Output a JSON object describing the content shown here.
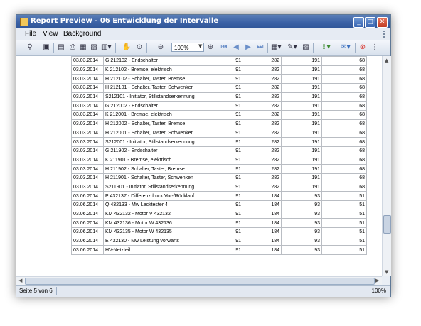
{
  "window": {
    "title": "Report Preview - 06 Entwicklung der Intervalle",
    "min_icon": "minimize-icon",
    "max_icon": "maximize-icon",
    "close_icon": "close-icon"
  },
  "menu": {
    "items": [
      "File",
      "View",
      "Background"
    ]
  },
  "toolbar": {
    "zoom_value": "100%",
    "icons": [
      "find-icon",
      "open-icon",
      "page-setup-icon",
      "print-icon",
      "quick-print-icon",
      "scale-icon",
      "multipage-icon",
      "hand-tool-icon",
      "magnifier-icon",
      "zoom-out-icon",
      "zoom-in-icon",
      "first-page-icon",
      "previous-page-icon",
      "next-page-icon",
      "last-page-icon",
      "watermark-icon",
      "background-color-icon",
      "page-layout-icon",
      "export-icon",
      "send-email-icon",
      "close-preview-icon"
    ]
  },
  "report": {
    "rows": [
      [
        "03.03.2014",
        "G 212102 - Endschalter",
        "91",
        "282",
        "191",
        "68"
      ],
      [
        "03.03.2014",
        "K 212102 - Bremse, elektrisch",
        "91",
        "282",
        "191",
        "68"
      ],
      [
        "03.03.2014",
        "H 212102 - Schalter, Taster, Bremse",
        "91",
        "282",
        "191",
        "68"
      ],
      [
        "03.03.2014",
        "H 212101 - Schalter, Taster, Schwenken",
        "91",
        "282",
        "191",
        "68"
      ],
      [
        "03.03.2014",
        "S212101 - Initiator, Stillstandserkennung",
        "91",
        "282",
        "191",
        "68"
      ],
      [
        "03.03.2014",
        "G 212002 - Endschalter",
        "91",
        "282",
        "191",
        "68"
      ],
      [
        "03.03.2014",
        "K 212001 - Bremse, elektrisch",
        "91",
        "282",
        "191",
        "68"
      ],
      [
        "03.03.2014",
        "H 212002 - Schalter, Taster, Bremse",
        "91",
        "282",
        "191",
        "68"
      ],
      [
        "03.03.2014",
        "H 212001 - Schalter, Taster, Schwenken",
        "91",
        "282",
        "191",
        "68"
      ],
      [
        "03.03.2014",
        "S212001 - Initiator, Stillstandserkennung",
        "91",
        "282",
        "191",
        "68"
      ],
      [
        "03.03.2014",
        "G 211902 - Endschalter",
        "91",
        "282",
        "191",
        "68"
      ],
      [
        "03.03.2014",
        "K 211901 - Bremse, elektrisch",
        "91",
        "282",
        "191",
        "68"
      ],
      [
        "03.03.2014",
        "H 211902 - Schalter, Taster, Bremse",
        "91",
        "282",
        "191",
        "68"
      ],
      [
        "03.03.2014",
        "H 211901 - Schalter, Taster, Schwenken",
        "91",
        "282",
        "191",
        "68"
      ],
      [
        "03.03.2014",
        "S211901 - Initiator, Stillstandserkennung",
        "91",
        "282",
        "191",
        "68"
      ],
      [
        "03.06.2014",
        "P 432137 - Differenzdruck Vor-/Rücklauf",
        "91",
        "184",
        "93",
        "51"
      ],
      [
        "03.06.2014",
        "Q 432133 - Mw Lecktester 4",
        "91",
        "184",
        "93",
        "51"
      ],
      [
        "03.06.2014",
        "KM 432132 - Motor V 432132",
        "91",
        "184",
        "93",
        "51"
      ],
      [
        "03.06.2014",
        "KM 432136 - Motor W 432136",
        "91",
        "184",
        "93",
        "51"
      ],
      [
        "03.06.2014",
        "KM 432135 - Motor W 432135",
        "91",
        "184",
        "93",
        "51"
      ],
      [
        "03.06.2014",
        "E 432130 - Mw Leistung vorwärts",
        "91",
        "184",
        "93",
        "51"
      ],
      [
        "03.06.2014",
        "HV-Netzteil",
        "91",
        "184",
        "93",
        "51"
      ]
    ]
  },
  "status": {
    "page": "Seite 5 von 6",
    "zoom": "100%"
  }
}
